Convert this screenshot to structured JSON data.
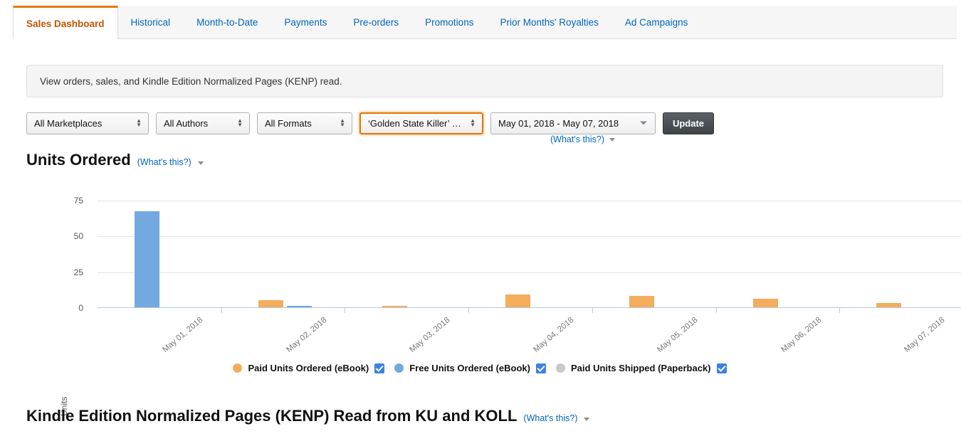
{
  "tabs": [
    {
      "label": "Sales Dashboard",
      "active": true
    },
    {
      "label": "Historical",
      "active": false
    },
    {
      "label": "Month-to-Date",
      "active": false
    },
    {
      "label": "Payments",
      "active": false
    },
    {
      "label": "Pre-orders",
      "active": false
    },
    {
      "label": "Promotions",
      "active": false
    },
    {
      "label": "Prior Months' Royalties",
      "active": false
    },
    {
      "label": "Ad Campaigns",
      "active": false
    }
  ],
  "banner": {
    "text": "View orders, sales, and Kindle Edition Normalized Pages (KENP) read."
  },
  "filters": {
    "marketplace": "All Marketplaces",
    "author": "All Authors",
    "format": "All Formats",
    "book": "‘Golden State Killer’ …",
    "date_range": "May 01, 2018 - May 07, 2018",
    "update_label": "Update",
    "whats_this": "(What's this?)"
  },
  "sections": {
    "units_title": "Units Ordered",
    "units_whats_this": "(What's this?)",
    "kenp_title": "Kindle Edition Normalized Pages (KENP) Read from KU and KOLL",
    "kenp_whats_this": "(What's this?)"
  },
  "colors": {
    "paid_ebook": "#f4ad5c",
    "free_ebook": "#72a9de",
    "paperback": "#c9c9c9",
    "accent_orange": "#e47911",
    "link_blue": "#0066c0",
    "checkbox_blue": "#3b82e0"
  },
  "legend": [
    {
      "label": "Paid Units Ordered (eBook)",
      "color": "#f4ad5c",
      "checked": true
    },
    {
      "label": "Free Units Ordered (eBook)",
      "color": "#72a9de",
      "checked": true
    },
    {
      "label": "Paid Units Shipped (Paperback)",
      "color": "#c9c9c9",
      "checked": true
    }
  ],
  "chart_data": {
    "type": "bar",
    "title": "Units Ordered",
    "xlabel": "",
    "ylabel": "Units",
    "ylim": [
      0,
      75
    ],
    "yticks": [
      0,
      25,
      50,
      75
    ],
    "grid": true,
    "legend_position": "bottom",
    "categories": [
      "May 01, 2018",
      "May 02, 2018",
      "May 03, 2018",
      "May 04, 2018",
      "May 05, 2018",
      "May 06, 2018",
      "May 07, 2018"
    ],
    "series": [
      {
        "name": "Paid Units Ordered (eBook)",
        "color": "#f4ad5c",
        "values": [
          0,
          5,
          1,
          9,
          8,
          6,
          3
        ]
      },
      {
        "name": "Free Units Ordered (eBook)",
        "color": "#72a9de",
        "values": [
          67,
          1,
          0,
          0,
          0,
          0,
          0
        ]
      },
      {
        "name": "Paid Units Shipped (Paperback)",
        "color": "#c9c9c9",
        "values": [
          0,
          0,
          0,
          0,
          0,
          0,
          0
        ]
      }
    ]
  }
}
